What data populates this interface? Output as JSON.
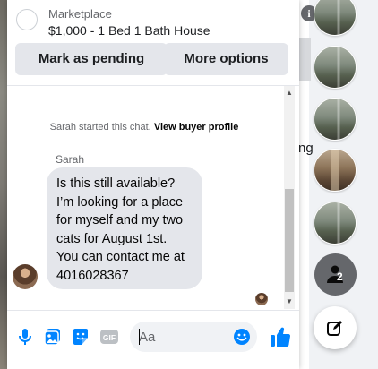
{
  "listing": {
    "category": "Marketplace",
    "title": "$1,000 - 1 Bed 1 Bath House"
  },
  "actions": {
    "mark_pending": "Mark as pending",
    "more_options": "More options"
  },
  "conversation": {
    "system_text": "Sarah started this chat.",
    "system_link": "View buyer profile",
    "sender": "Sarah",
    "message_lines": [
      "Is this still available?",
      "I’m looking for a place",
      "for myself and my two",
      "cats for August 1st.",
      "You can contact me at",
      "4016028367"
    ]
  },
  "composer": {
    "placeholder": "Aa",
    "icons": [
      "microphone-icon",
      "photo-icon",
      "sticker-icon",
      "gif-icon",
      "emoji-icon",
      "like-icon"
    ],
    "gif_label": "GIF"
  },
  "background": {
    "partial_text": "ng",
    "info_glyph": "i"
  },
  "sidebar": {
    "group_count": "2"
  },
  "colors": {
    "accent": "#0084ff",
    "bubble": "#e4e6eb",
    "secondary_text": "#65676b"
  }
}
